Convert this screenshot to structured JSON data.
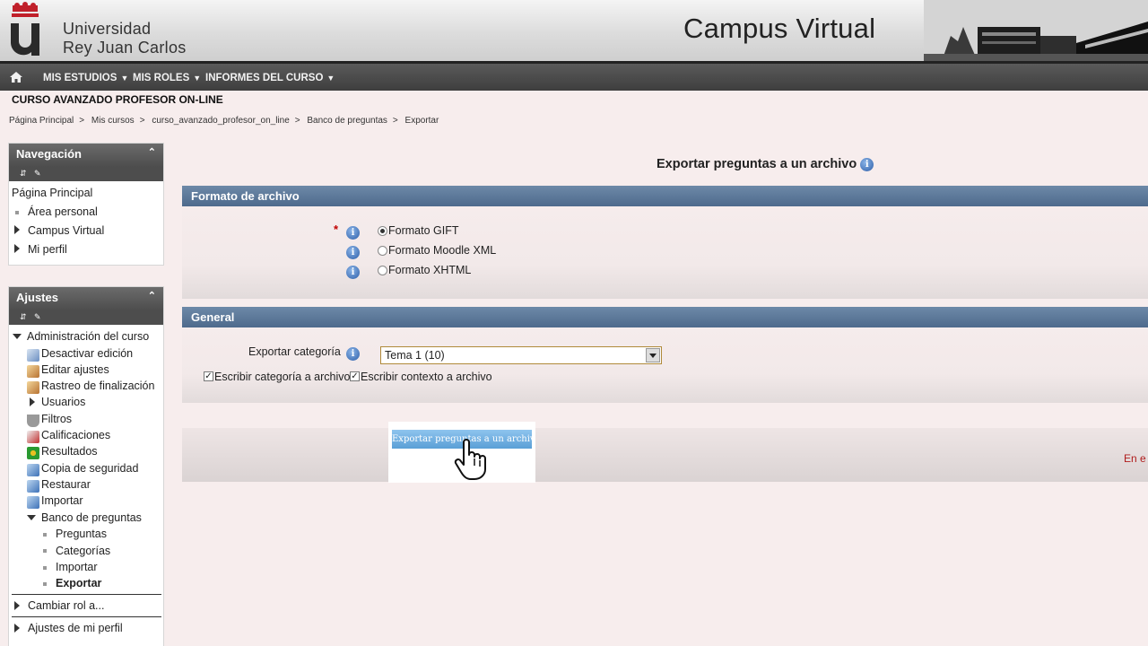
{
  "header": {
    "university_line1": "Universidad",
    "university_line2": "Rey Juan Carlos",
    "campus_title": "Campus Virtual"
  },
  "navbar": {
    "items": [
      {
        "label": "MIS ESTUDIOS"
      },
      {
        "label": "MIS ROLES"
      },
      {
        "label": "INFORMES DEL CURSO"
      }
    ]
  },
  "course_title": "CURSO AVANZADO PROFESOR ON-LINE",
  "breadcrumb": [
    "Página Principal",
    "Mis cursos",
    "curso_avanzado_profesor_on_line",
    "Banco de preguntas",
    "Exportar"
  ],
  "navigation_block": {
    "title": "Navegación",
    "items": [
      "Página Principal",
      "Área personal",
      "Campus Virtual",
      "Mi perfil"
    ]
  },
  "settings_block": {
    "title": "Ajustes",
    "admin_label": "Administración del curso",
    "items": [
      "Desactivar edición",
      "Editar ajustes",
      "Rastreo de finalización",
      "Usuarios",
      "Filtros",
      "Calificaciones",
      "Resultados",
      "Copia de seguridad",
      "Restaurar",
      "Importar",
      "Banco de preguntas"
    ],
    "bank_items": [
      "Preguntas",
      "Categorías",
      "Importar",
      "Exportar"
    ],
    "switch_role": "Cambiar rol a...",
    "profile_settings": "Ajustes de mi perfil"
  },
  "main": {
    "heading": "Exportar preguntas a un archivo",
    "format_legend": "Formato de archivo",
    "required_mark": "*",
    "formats": [
      {
        "label": "Formato GIFT",
        "checked": true
      },
      {
        "label": "Formato Moodle XML",
        "checked": false
      },
      {
        "label": "Formato XHTML",
        "checked": false
      }
    ],
    "general_legend": "General",
    "category_label": "Exportar categoría",
    "category_value": "Tema 1 (10)",
    "checkbox_category": "Escribir categoría a archivo",
    "checkbox_context": "Escribir contexto a archivo",
    "export_button": "Exportar preguntas a un archivo",
    "cut_text": "En e"
  },
  "colors": {
    "legend_bar": "#5b7797",
    "sidebar_header": "#5a5a5a",
    "button": "#6fb0e2",
    "required": "#c00000"
  },
  "icons": [
    "home-icon",
    "info-icon",
    "collapse-icon",
    "hand-cursor-icon"
  ]
}
